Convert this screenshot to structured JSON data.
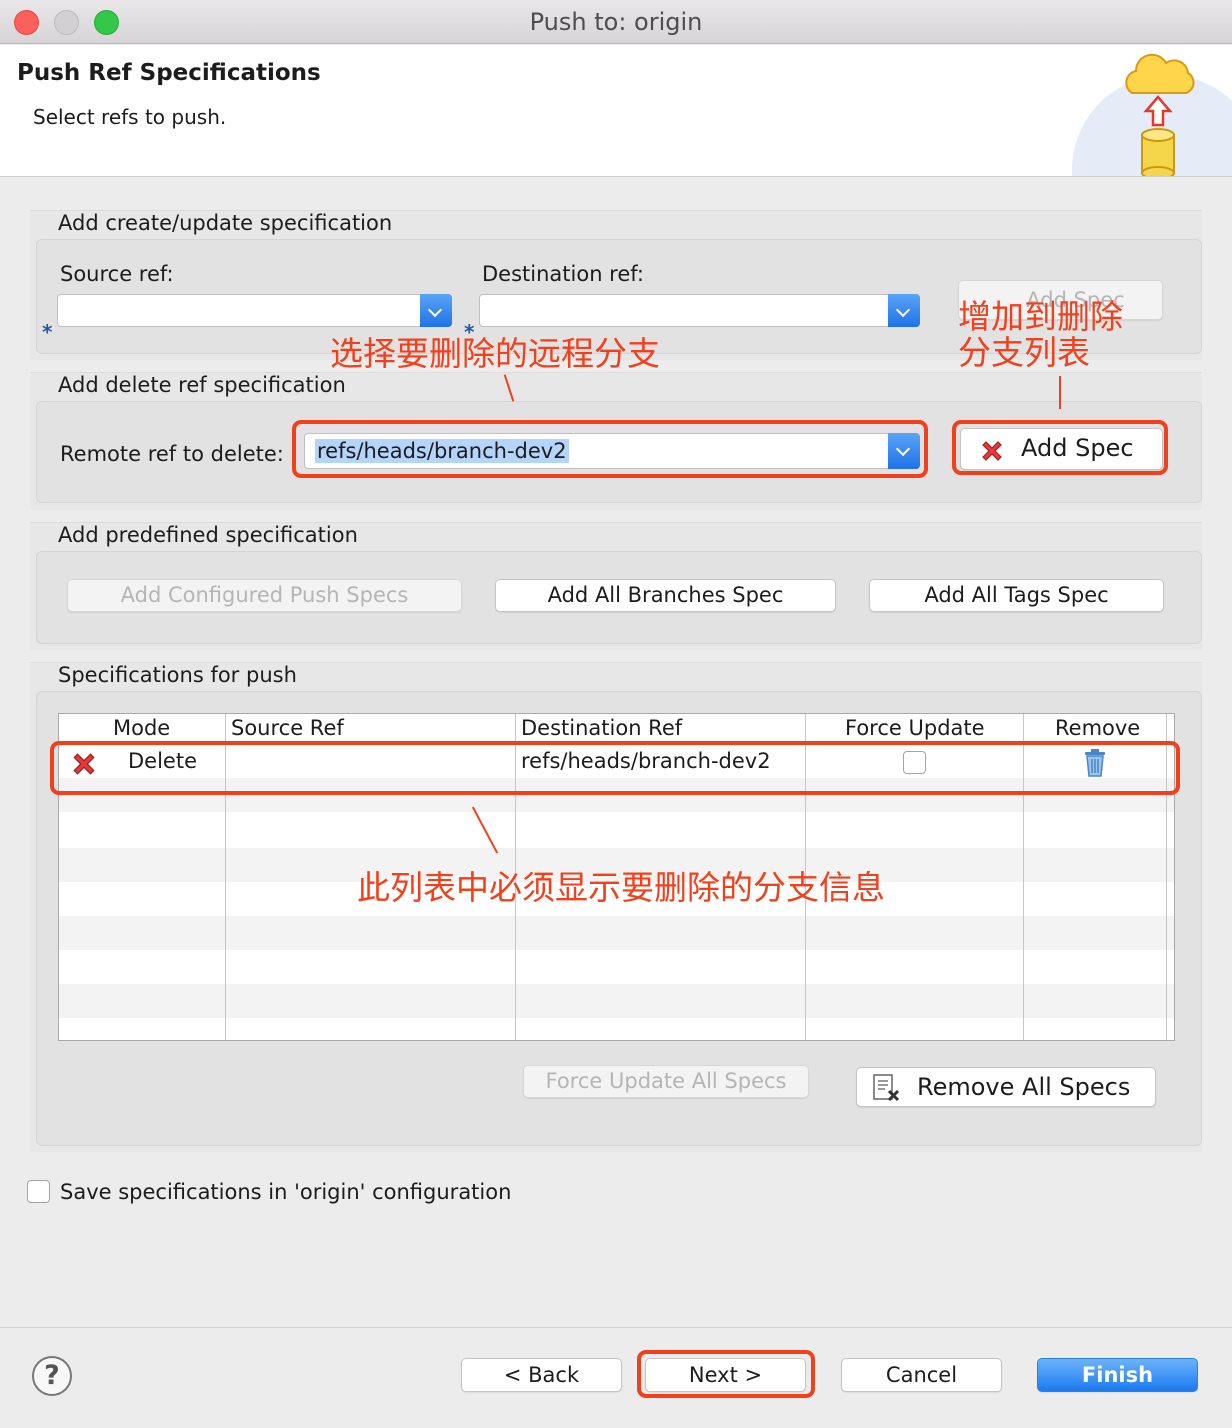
{
  "window": {
    "title": "Push to: origin"
  },
  "header": {
    "title": "Push Ref Specifications",
    "subtitle": "Select refs to push."
  },
  "create_update": {
    "label": "Add create/update specification",
    "source_label": "Source ref:",
    "source_value": "",
    "dest_label": "Destination ref:",
    "dest_value": "",
    "add_spec_label": "Add Spec"
  },
  "delete_ref": {
    "label": "Add delete ref specification",
    "remote_label": "Remote ref to delete:",
    "remote_value": "refs/heads/branch-dev2",
    "add_spec_label": "Add Spec"
  },
  "predefined": {
    "label": "Add predefined specification",
    "configured_label": "Add Configured Push Specs",
    "all_branches_label": "Add All Branches Spec",
    "all_tags_label": "Add All Tags Spec"
  },
  "specs": {
    "label": "Specifications for push",
    "columns": [
      "Mode",
      "Source Ref",
      "Destination Ref",
      "Force Update",
      "Remove"
    ],
    "rows": [
      {
        "mode": "Delete",
        "source": "",
        "destination": "refs/heads/branch-dev2",
        "force_update": false
      }
    ],
    "force_all_label": "Force Update All Specs",
    "remove_all_label": "Remove All Specs"
  },
  "save_config_label": "Save specifications in 'origin' configuration",
  "buttons": {
    "back": "< Back",
    "next": "Next >",
    "cancel": "Cancel",
    "finish": "Finish"
  },
  "help_glyph": "?",
  "annotations": {
    "select_remote": "选择要删除的远程分支",
    "add_to_list_1": "增加到删除",
    "add_to_list_2": "分支列表",
    "list_note": "此列表中必须显示要删除的分支信息"
  },
  "colors": {
    "annotation": "#f2401c",
    "accent": "#2072e7"
  }
}
